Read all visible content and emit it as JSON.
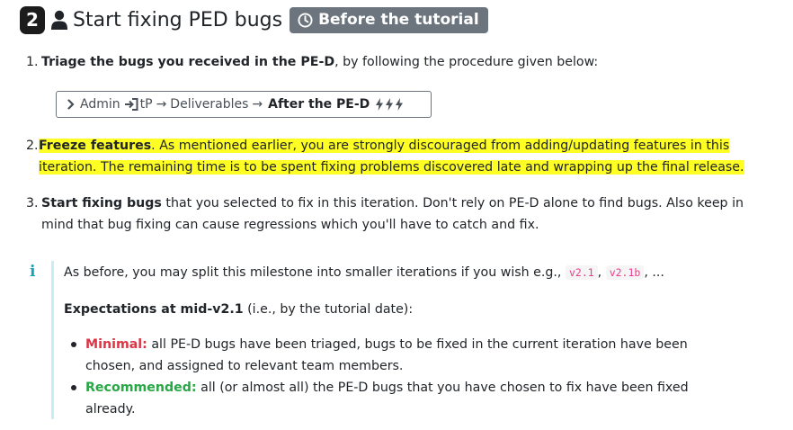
{
  "heading": {
    "number": "2",
    "title": "Start fixing PED bugs",
    "badge_label": "Before the tutorial",
    "icons": [
      "person-icon",
      "clock-icon"
    ]
  },
  "step1": {
    "number": "1.",
    "bold": "Triage the bugs you received in the PE-D",
    "rest": ", by following the procedure given below:",
    "path": {
      "prefix_icon": "chevron-right-icon",
      "admin": "Admin",
      "link_icon": "sign-in-icon",
      "tp": "tP",
      "arrow1": "→",
      "deliverables": "Deliverables",
      "arrow2": "→",
      "last": "After the PE-D",
      "trailing_icons": [
        "bolt-icon",
        "bolt-icon",
        "bolt-icon"
      ]
    }
  },
  "step2": {
    "number": "2.",
    "bold": "Freeze features",
    "line1_rest": ". As mentioned earlier, you are strongly discouraged from adding/updating features in this",
    "line2": "iteration. The remaining time is to be spent fixing problems discovered late and wrapping up the final release.",
    "highlight_color": "#ffff24"
  },
  "step3": {
    "number": "3.",
    "bold": "Start fixing bugs",
    "line1_rest": " that you selected to fix in this iteration. Don't rely on PE-D alone to find bugs. Also keep in",
    "line2": "mind that bug fixing can cause regressions which you'll have to catch and fix."
  },
  "callout": {
    "icon": "info-icon",
    "intro_text": "As before, you may split this milestone into smaller iterations if you wish e.g.,",
    "code1": "v2.1",
    "sep": ",",
    "code2": "v2.1b",
    "ellipsis": ", ...",
    "expect_bold": "Expectations at mid-v2.1",
    "expect_rest": " (i.e., by the tutorial date):",
    "items": [
      {
        "label": "Minimal:",
        "line1": " all PE-D bugs have been triaged, bugs to be fixed in the current iteration have been",
        "line2": "chosen, and assigned to relevant team members.",
        "color": "#dc3545"
      },
      {
        "label": "Recommended:",
        "line1": " all (or almost all) the PE-D bugs that you have chosen to fix have been fixed",
        "line2": "already.",
        "color": "#28a745"
      }
    ]
  }
}
